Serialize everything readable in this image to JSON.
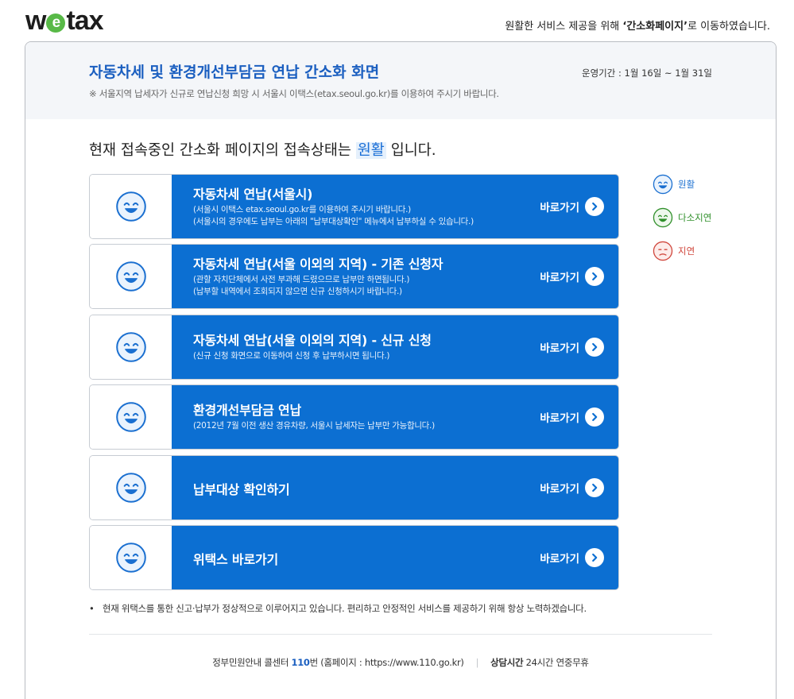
{
  "header": {
    "logo_text_pre": "w",
    "logo_text_e": "e",
    "logo_text_post": "tax",
    "notice_pre": "원활한 서비스 제공을 위해 ",
    "notice_bold": "‘간소화페이지’",
    "notice_post": "로 이동하였습니다."
  },
  "card": {
    "title": "자동차세 및 환경개선부담금 연납 간소화 화면",
    "subtitle": "※ 서울지역 납세자가 신규로 연납신청 희망 시 서울시 이택스(etax.seoul.go.kr)를 이용하여 주시기 바랍니다.",
    "period": "운영기간 : 1월 16일 ~ 1월 31일"
  },
  "status": {
    "pre": "현재 접속중인 간소화 페이지의 접속상태는 ",
    "state": "원활",
    "post": " 입니다."
  },
  "go_label": "바로가기",
  "rows": [
    {
      "title": "자동차세 연납(서울시)",
      "desc1": "(서울시 이택스 etax.seoul.go.kr를 이용하여 주시기 바랍니다.)",
      "desc2": "(서울시의 경우에도 납부는 아래의 \"납부대상확인\" 메뉴에서 납부하실 수 있습니다.)"
    },
    {
      "title": "자동차세 연납(서울 이외의 지역) - 기존 신청자",
      "desc1": "(관할 자치단체에서 사전 부과해 드렸으므로 납부만 하면됩니다.)",
      "desc2": "(납부할 내역에서 조회되지 않으면 신규 신청하시기 바랍니다.)"
    },
    {
      "title": "자동차세 연납(서울 이외의 지역) - 신규 신청",
      "desc1": "(신규 신청 화면으로 이동하여 신청 후 납부하시면 됩니다.)",
      "desc2": ""
    },
    {
      "title": "환경개선부담금 연납",
      "desc1": "(2012년 7월 이전 생산 경유차량, 서울시 납세자는 납부만 가능합니다.)",
      "desc2": ""
    },
    {
      "title": "납부대상 확인하기",
      "desc1": "",
      "desc2": ""
    },
    {
      "title": "위택스 바로가기",
      "desc1": "",
      "desc2": ""
    }
  ],
  "legend": {
    "good": "원활",
    "mid": "다소지연",
    "slow": "지연"
  },
  "colors": {
    "brand_blue": "#0c6fd2",
    "good": "#1a6fd0",
    "mid": "#2f8f2a",
    "slow": "#d0463c",
    "logo_e": "#58b947"
  },
  "bullet_note": "현재 위택스를 통한 신고·납부가 정상적으로 이루어지고 있습니다. 편리하고 안정적인 서비스를 제공하기 위해 항상 노력하겠습니다.",
  "footer": {
    "pre": "정부민원안내 콜센터 ",
    "number": "110",
    "mid": "번 (홈페이지 : https://www.110.go.kr)",
    "sep": "|",
    "hours_label": "상담시간",
    "hours_value": " 24시간 연중무휴"
  }
}
